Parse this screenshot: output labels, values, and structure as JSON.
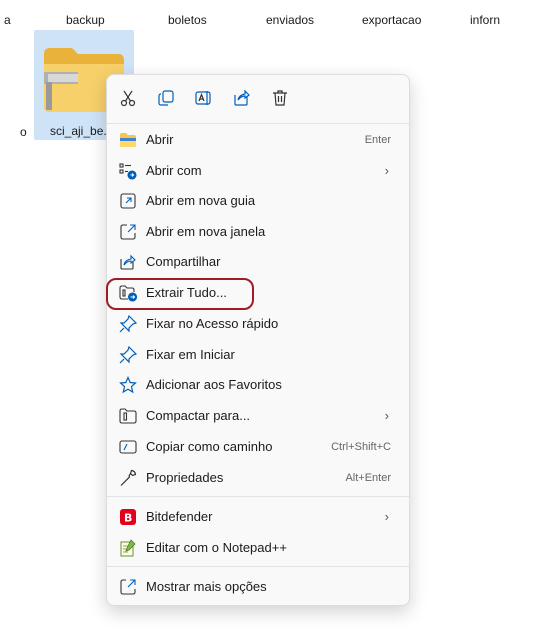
{
  "explorer": {
    "top_folders": [
      "a",
      "backup",
      "boletos",
      "enviados",
      "exportacao",
      "inforn"
    ],
    "second_row_partial": "o",
    "selected_file_name": "sci_aji_be..."
  },
  "context_menu": {
    "toolbar": [
      {
        "name": "cut",
        "icon": "scissors-icon"
      },
      {
        "name": "copy",
        "icon": "copy-icon"
      },
      {
        "name": "rename",
        "icon": "rename-icon"
      },
      {
        "name": "share",
        "icon": "share-icon"
      },
      {
        "name": "delete",
        "icon": "trash-icon"
      }
    ],
    "items": [
      {
        "label": "Abrir",
        "shortcut": "Enter",
        "icon": "folder-icon"
      },
      {
        "label": "Abrir com",
        "submenu": true,
        "icon": "open-with-icon"
      },
      {
        "label": "Abrir em nova guia",
        "icon": "new-tab-icon"
      },
      {
        "label": "Abrir em nova janela",
        "icon": "new-window-icon"
      },
      {
        "label": "Compartilhar",
        "icon": "share-icon"
      },
      {
        "label": "Extrair Tudo...",
        "icon": "extract-icon"
      },
      {
        "label": "Fixar no Acesso rápido",
        "icon": "pin-icon"
      },
      {
        "label": "Fixar em Iniciar",
        "icon": "pin-icon"
      },
      {
        "label": "Adicionar aos Favoritos",
        "icon": "star-icon"
      },
      {
        "label": "Compactar para...",
        "submenu": true,
        "icon": "compress-icon"
      },
      {
        "label": "Copiar como caminho",
        "shortcut": "Ctrl+Shift+C",
        "icon": "path-icon"
      },
      {
        "label": "Propriedades",
        "shortcut": "Alt+Enter",
        "icon": "wrench-icon"
      },
      {
        "label": "Bitdefender",
        "submenu": true,
        "icon": "bitdefender-icon"
      },
      {
        "label": "Editar com o Notepad++",
        "icon": "notepad-icon"
      },
      {
        "label": "Mostrar mais opções",
        "icon": "more-options-icon"
      }
    ]
  },
  "colors": {
    "accent": "#005fb8",
    "highlight_ring": "#a01c24",
    "folder_yellow": "#f6c64a",
    "bitdefender_red": "#e2001a"
  }
}
